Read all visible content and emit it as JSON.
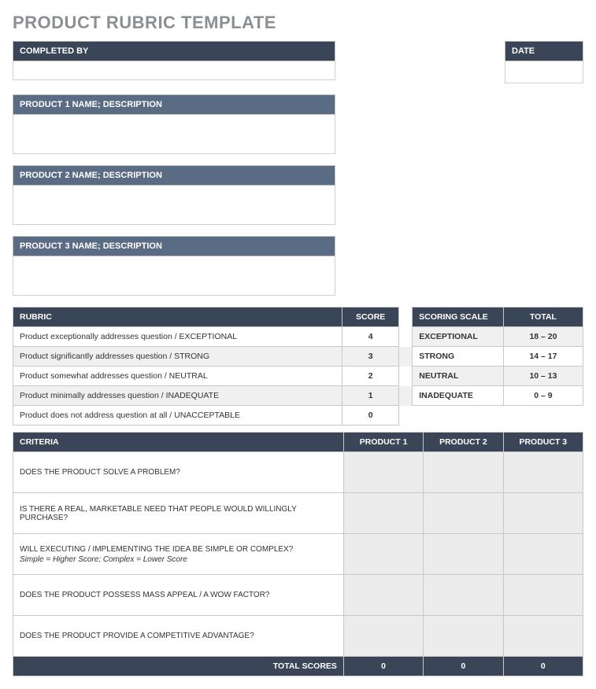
{
  "title": "PRODUCT RUBRIC TEMPLATE",
  "header": {
    "completed_by_label": "COMPLETED BY",
    "completed_by_value": "",
    "date_label": "DATE",
    "date_value": ""
  },
  "products": [
    {
      "label": "PRODUCT 1 NAME; DESCRIPTION",
      "value": ""
    },
    {
      "label": "PRODUCT 2 NAME; DESCRIPTION",
      "value": ""
    },
    {
      "label": "PRODUCT 3 NAME; DESCRIPTION",
      "value": ""
    }
  ],
  "rubric": {
    "headers": {
      "rubric": "RUBRIC",
      "score": "SCORE",
      "scale": "SCORING SCALE",
      "total": "TOTAL"
    },
    "rows": [
      {
        "desc": "Product exceptionally addresses question / EXCEPTIONAL",
        "score": "4",
        "scale": "EXCEPTIONAL",
        "total": "18 – 20"
      },
      {
        "desc": "Product significantly addresses question / STRONG",
        "score": "3",
        "scale": "STRONG",
        "total": "14 – 17"
      },
      {
        "desc": "Product somewhat addresses question / NEUTRAL",
        "score": "2",
        "scale": "NEUTRAL",
        "total": "10 – 13"
      },
      {
        "desc": "Product minimally addresses question / INADEQUATE",
        "score": "1",
        "scale": "INADEQUATE",
        "total": "0 – 9"
      },
      {
        "desc": "Product does not address question at all / UNACCEPTABLE",
        "score": "0",
        "scale": "",
        "total": ""
      }
    ]
  },
  "criteria": {
    "headers": {
      "criteria": "CRITERIA",
      "p1": "PRODUCT 1",
      "p2": "PRODUCT 2",
      "p3": "PRODUCT 3"
    },
    "rows": [
      {
        "text": "DOES THE PRODUCT SOLVE A PROBLEM?",
        "sub": ""
      },
      {
        "text": "IS THERE A REAL, MARKETABLE NEED THAT PEOPLE WOULD WILLINGLY PURCHASE?",
        "sub": ""
      },
      {
        "text": "WILL EXECUTING / IMPLEMENTING THE IDEA BE SIMPLE OR COMPLEX?",
        "sub": "Simple = Higher Score; Complex = Lower Score"
      },
      {
        "text": "DOES THE PRODUCT POSSESS MASS APPEAL / A WOW FACTOR?",
        "sub": ""
      },
      {
        "text": "DOES THE PRODUCT PROVIDE A COMPETITIVE ADVANTAGE?",
        "sub": ""
      }
    ],
    "total_label": "TOTAL SCORES",
    "totals": {
      "p1": "0",
      "p2": "0",
      "p3": "0"
    }
  }
}
